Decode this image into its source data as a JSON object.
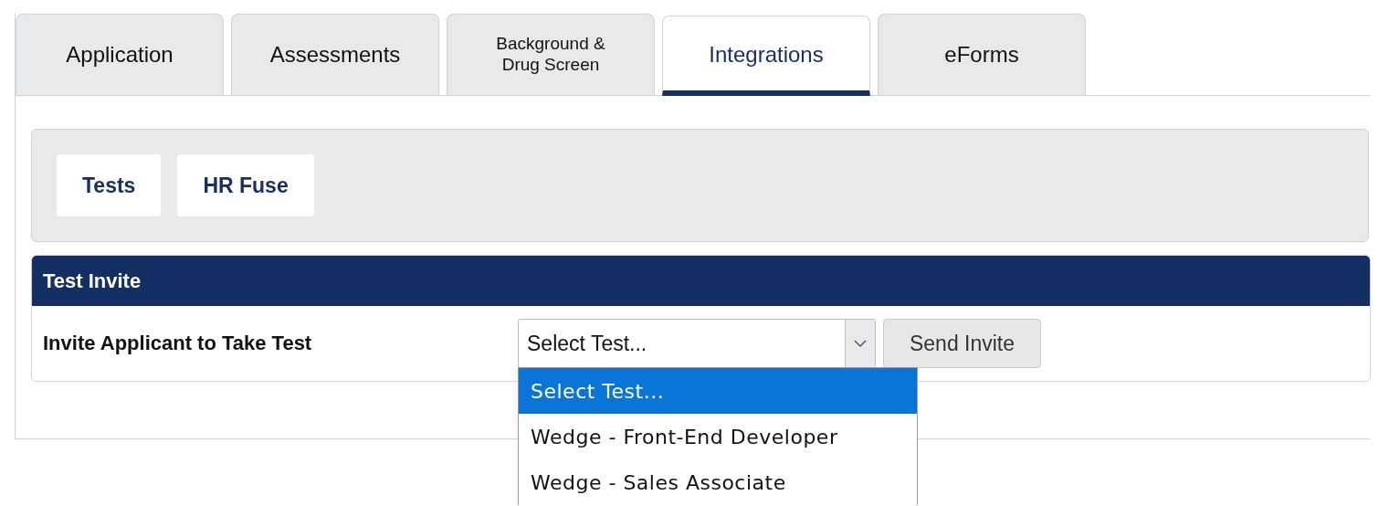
{
  "tabs": [
    {
      "label": "Application",
      "selected": false
    },
    {
      "label": "Assessments",
      "selected": false
    },
    {
      "label": "Background &\nDrug Screen",
      "selected": false
    },
    {
      "label": "Integrations",
      "selected": true
    },
    {
      "label": "eForms",
      "selected": false
    }
  ],
  "subnav": [
    {
      "label": "Tests"
    },
    {
      "label": "HR Fuse"
    }
  ],
  "section": {
    "title": "Test Invite",
    "field_label": "Invite Applicant to Take Test",
    "select": {
      "value": "Select Test...",
      "expanded": true,
      "options": [
        {
          "label": "Select Test...",
          "selected": true
        },
        {
          "label": "Wedge - Front-End Developer",
          "selected": false
        },
        {
          "label": "Wedge - Sales Associate",
          "selected": false
        }
      ]
    },
    "button": "Send Invite"
  }
}
